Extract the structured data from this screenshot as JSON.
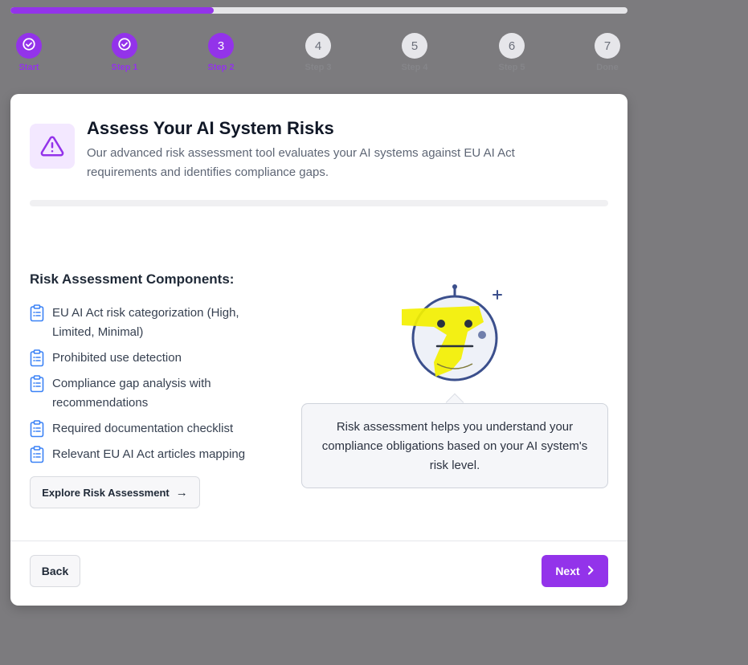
{
  "progress": {
    "fraction": 0.33
  },
  "steps": [
    {
      "label": "Start",
      "number": "",
      "status": "done"
    },
    {
      "label": "Step 1",
      "number": "",
      "status": "done"
    },
    {
      "label": "Step 2",
      "number": "3",
      "status": "current"
    },
    {
      "label": "Step 3",
      "number": "4",
      "status": "todo"
    },
    {
      "label": "Step 4",
      "number": "5",
      "status": "todo"
    },
    {
      "label": "Step 5",
      "number": "6",
      "status": "todo"
    },
    {
      "label": "Done",
      "number": "7",
      "status": "todo"
    }
  ],
  "card": {
    "title": "Assess Your AI System Risks",
    "description": "Our advanced risk assessment tool evaluates your AI systems against EU AI Act requirements and identifies compliance gaps.",
    "section_title": "Risk Assessment Components:",
    "components": [
      "EU AI Act risk categorization (High, Limited, Minimal)",
      "Prohibited use detection",
      "Compliance gap analysis with recommendations",
      "Required documentation checklist",
      "Relevant EU AI Act articles mapping"
    ],
    "explore_label": "Explore Risk Assessment",
    "info_text": "Risk assessment helps you understand your compliance obligations based on your AI system's risk level."
  },
  "footer": {
    "back_label": "Back",
    "next_label": "Next"
  },
  "colors": {
    "accent": "#9333ea",
    "mascot_outline": "#3b4f8c",
    "highlight": "#f3f000"
  },
  "icons": [
    "check-circle-icon",
    "warning-triangle-icon",
    "clipboard-list-icon",
    "arrow-right-icon",
    "chevron-right-icon"
  ]
}
